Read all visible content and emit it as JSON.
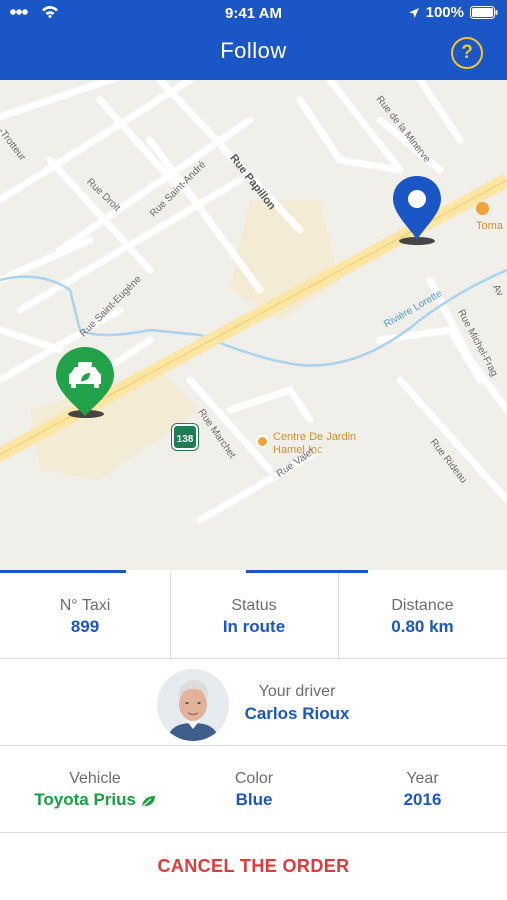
{
  "status_bar": {
    "time": "9:41 AM",
    "battery": "100%"
  },
  "header": {
    "title": "Follow",
    "help_label": "?"
  },
  "map": {
    "route_number": "138",
    "labels": {
      "rue_trotteur": "-Trotteur",
      "rue_minerve": "Rue de la Minerve",
      "rue_droit": "Rue Droit",
      "rue_saint_andre": "Rue Saint-André",
      "rue_papillon": "Rue Papillon",
      "rue_saint_eugene": "Rue Saint-Eugène",
      "riviere_lorette": "Rivière Lorette",
      "rue_michel_fragasso": "Rue Michel-Frag",
      "rue_marchet": "Rue Marchet",
      "rue_valet": "Rue Valet",
      "rue_rideau": "Rue Rideau",
      "av": "Av",
      "poi_centre": "Centre De Jardin\nHamel Inc",
      "poi_toma": "Toma"
    },
    "colors": {
      "taxi_pin": "#22a24a",
      "destination_pin": "#1b56c6",
      "road_major": "#fbe6a6"
    }
  },
  "info": {
    "taxi": {
      "label": "N° Taxi",
      "value": "899"
    },
    "status": {
      "label": "Status",
      "value": "In route"
    },
    "distance": {
      "label": "Distance",
      "value": "0.80 km"
    }
  },
  "driver": {
    "label": "Your driver",
    "name": "Carlos Rioux"
  },
  "vehicle": {
    "vehicle": {
      "label": "Vehicle",
      "value": "Toyota Prius"
    },
    "color": {
      "label": "Color",
      "value": "Blue"
    },
    "year": {
      "label": "Year",
      "value": "2016"
    }
  },
  "actions": {
    "cancel_label": "CANCEL THE ORDER"
  },
  "theme": {
    "primary": "#1b56c6",
    "accent": "#f3c42b",
    "danger": "#e03a3a",
    "eco": "#18a040"
  }
}
